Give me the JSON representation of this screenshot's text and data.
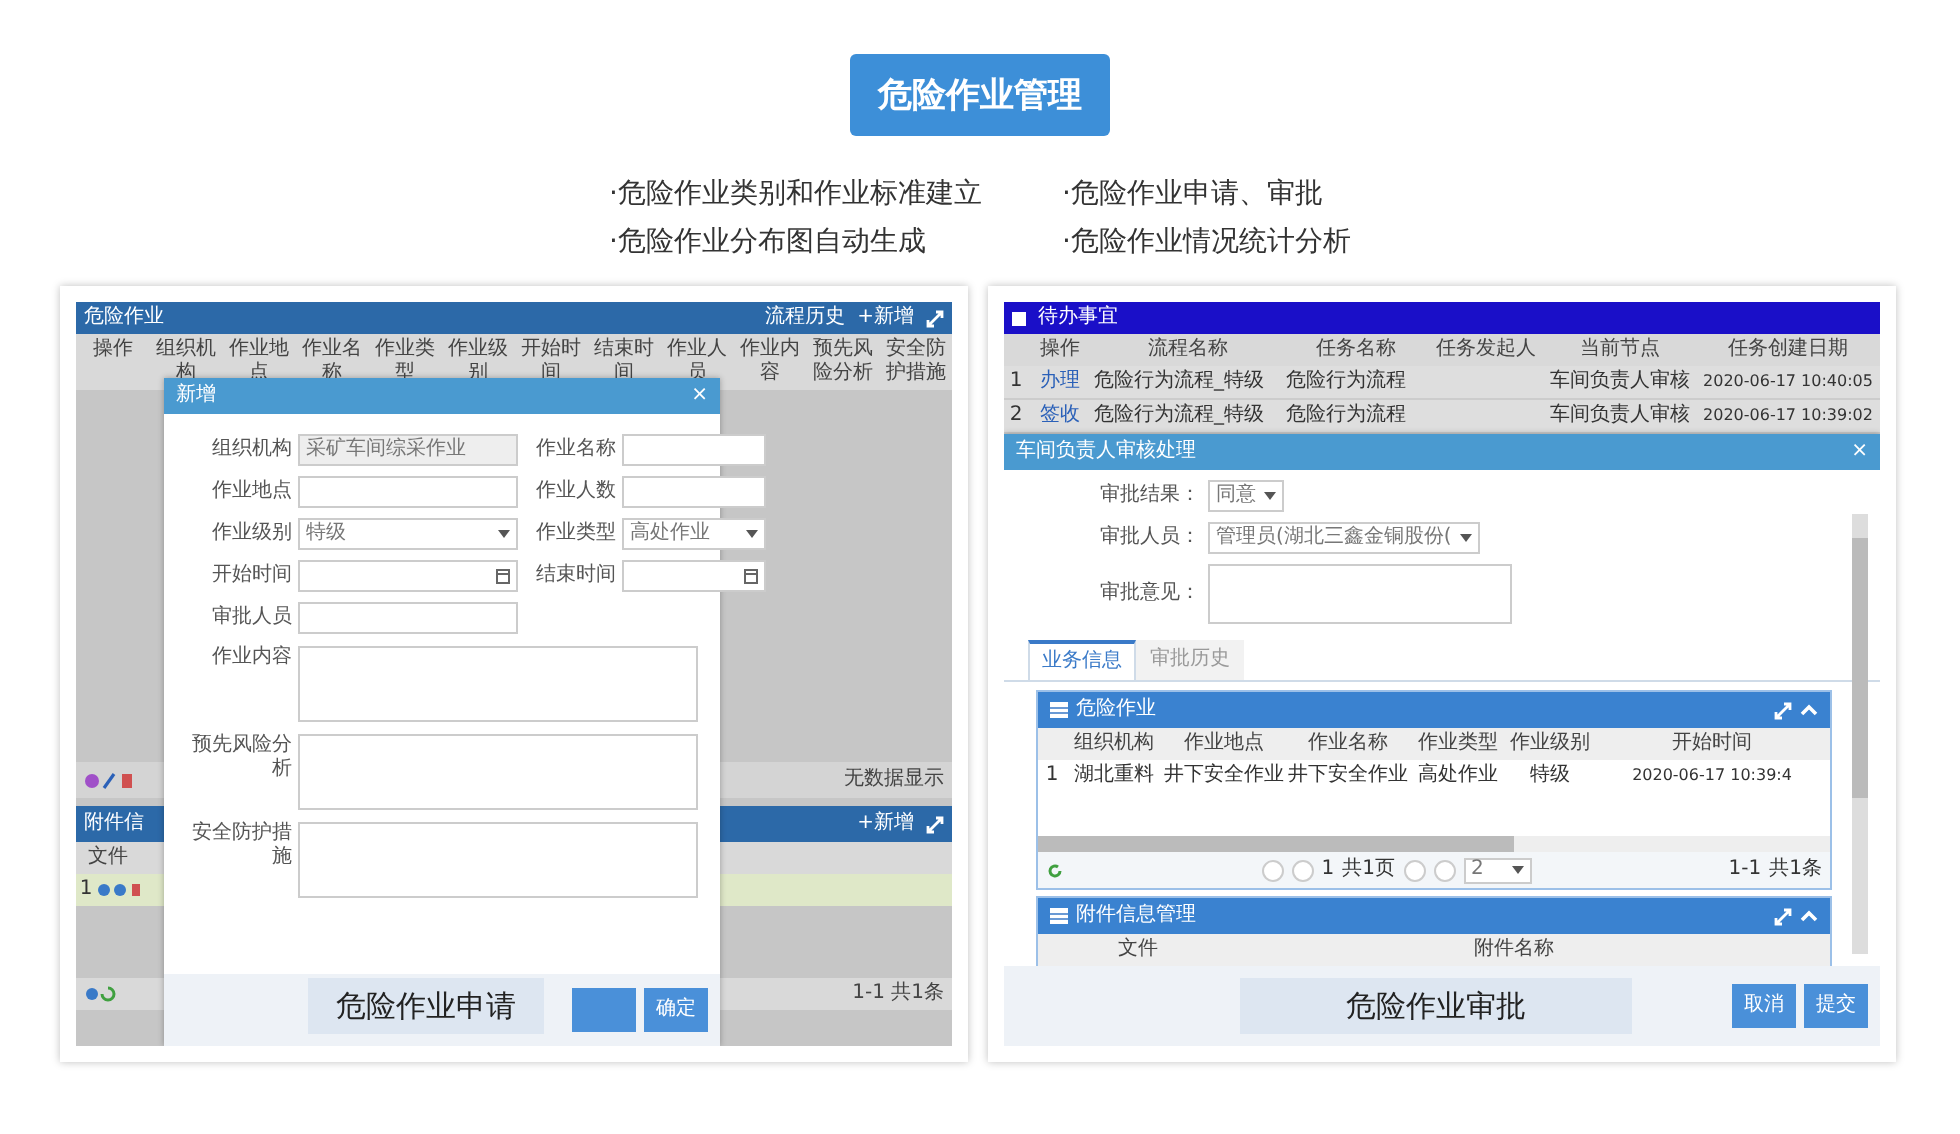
{
  "title": "危险作业管理",
  "features": [
    "·危险作业类别和作业标准建立",
    "·危险作业申请、审批",
    "·危险作业分布图自动生成",
    "·危险作业情况统计分析"
  ],
  "apply_screen": {
    "caption": "危险作业申请",
    "window_title": "危险作业",
    "toolbar_buttons": [
      "流程历史",
      "+新增"
    ],
    "columns": [
      "操作",
      "组织机构",
      "作业地点",
      "作业名称",
      "作业类型",
      "作业级别",
      "开始时间",
      "结束时间",
      "作业人员",
      "作业内容",
      "预先风险分析",
      "安全防护措施"
    ],
    "dialog": {
      "title": "新增",
      "close": "×",
      "fields": [
        {
          "label": "组织机构",
          "kind": "readonly",
          "value": "采矿车间综采作业"
        },
        {
          "label": "作业名称",
          "kind": "text"
        },
        {
          "label": "作业地点",
          "kind": "text"
        },
        {
          "label": "作业人数",
          "kind": "text"
        },
        {
          "label": "作业级别",
          "kind": "select",
          "value": "特级"
        },
        {
          "label": "作业类型",
          "kind": "select",
          "value": "高处作业"
        },
        {
          "label": "开始时间",
          "kind": "date"
        },
        {
          "label": "结束时间",
          "kind": "date"
        },
        {
          "label": "审批人员",
          "kind": "text"
        }
      ],
      "textareas": [
        "作业内容",
        "预先风险分析",
        "安全防护措施"
      ],
      "confirm": "确定"
    },
    "list_status": "无数据显示",
    "attachments": {
      "title": "附件信",
      "add": "+新增",
      "column": "文件",
      "row_index": "1"
    },
    "pager": "1-1 共1条"
  },
  "approve_screen": {
    "caption": "危险作业审批",
    "todo": {
      "title": "待办事宜",
      "columns": [
        "操作",
        "流程名称",
        "任务名称",
        "任务发起人",
        "当前节点",
        "任务创建日期"
      ],
      "rows": [
        {
          "index": "1",
          "action": "办理",
          "process": "危险行为流程_特级",
          "task": "危险行为流程",
          "node": "车间负责人审核",
          "created": "2020-06-17 10:40:05"
        },
        {
          "index": "2",
          "action": "签收",
          "process": "危险行为流程_特级",
          "task": "危险行为流程",
          "node": "车间负责人审核",
          "created": "2020-06-17 10:39:02"
        }
      ]
    },
    "dialog": {
      "title": "车间负责人审核处理",
      "close": "×",
      "fields": [
        {
          "label": "审批结果：",
          "kind": "select",
          "value": "同意"
        },
        {
          "label": "审批人员：",
          "kind": "select",
          "value": "管理员(湖北三鑫金铜股份("
        },
        {
          "label": "审批意见：",
          "kind": "textarea"
        }
      ],
      "tabs": [
        {
          "label": "业务信息",
          "selected": true
        },
        {
          "label": "审批历史",
          "selected": false
        }
      ],
      "work_panel": {
        "title": "危险作业",
        "columns": [
          "组织机构",
          "作业地点",
          "作业名称",
          "作业类型",
          "作业级别",
          "开始时间"
        ],
        "rows": [
          {
            "index": "1",
            "cells": [
              "湖北重料",
              "井下安全作业",
              "井下安全作业",
              "高处作业",
              "特级",
              "2020-06-17 10:39:4"
            ]
          }
        ],
        "pager": {
          "page": "1",
          "pages": "共1页",
          "size": "2",
          "range": "1-1",
          "total": "共1条"
        }
      },
      "attach_panel": {
        "title": "附件信息管理",
        "columns": [
          "文件",
          "附件名称"
        ]
      },
      "buttons": [
        "取消",
        "提交"
      ]
    }
  }
}
